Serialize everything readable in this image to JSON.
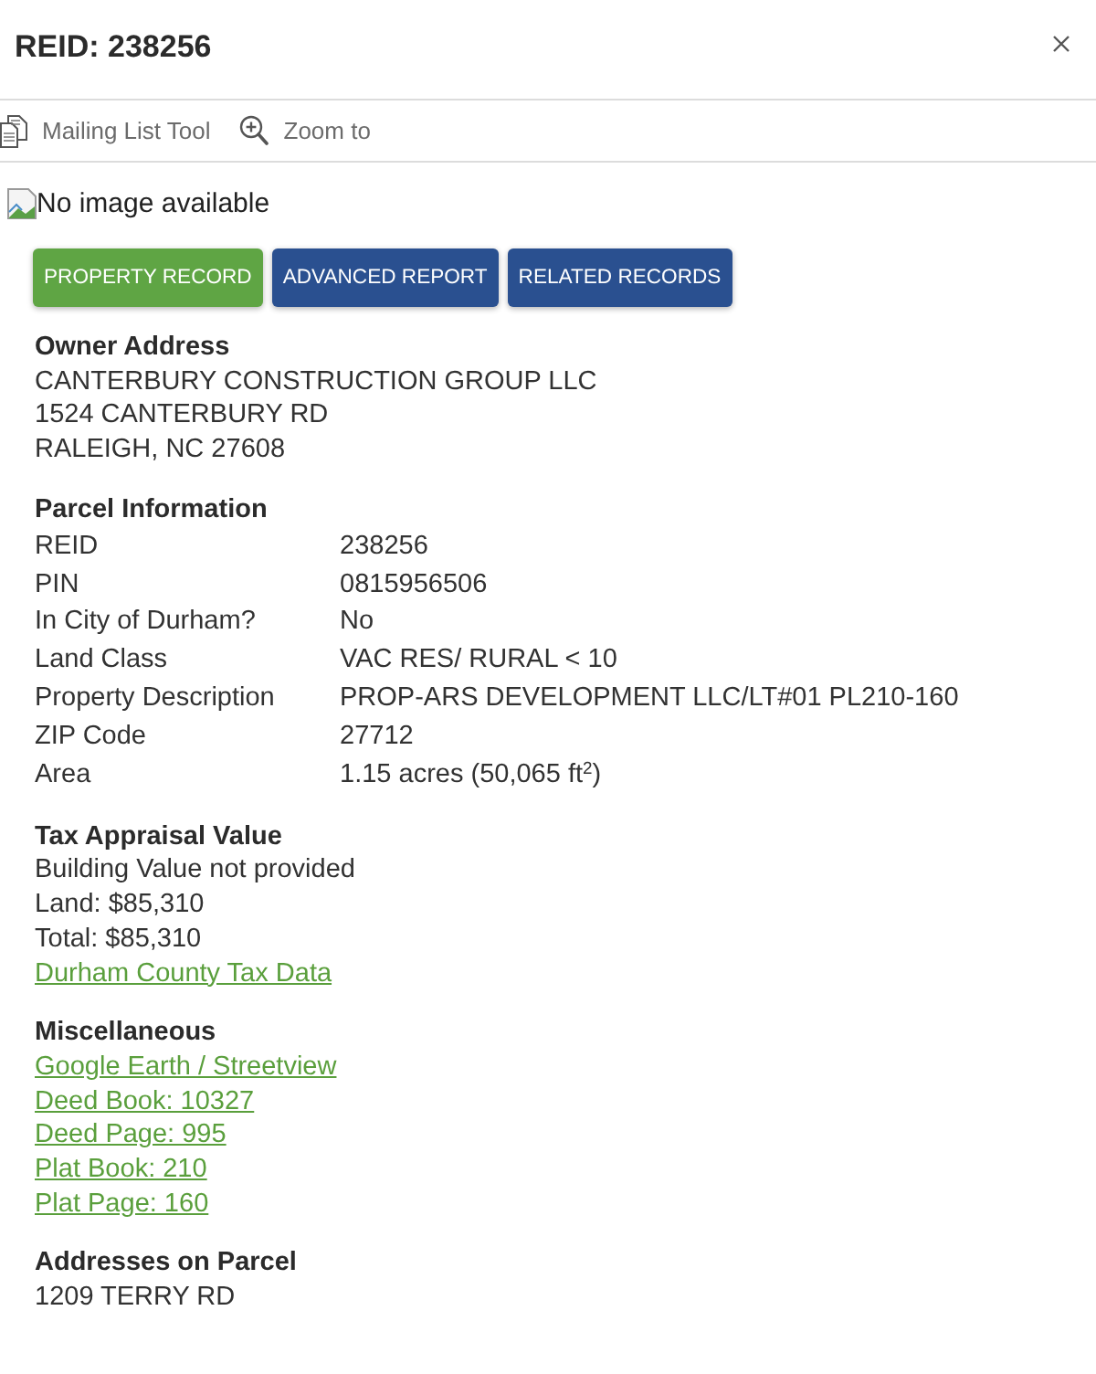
{
  "header": {
    "title": "REID: 238256"
  },
  "toolbar": [
    {
      "kind": "mailing",
      "label": "Mailing List Tool"
    },
    {
      "kind": "zoom",
      "label": "Zoom to"
    }
  ],
  "image": {
    "alt": "No image available"
  },
  "buttons": [
    {
      "label": "PROPERTY RECORD",
      "color": "#5fa544"
    },
    {
      "label": "ADVANCED REPORT",
      "color": "#2a5090"
    },
    {
      "label": "RELATED RECORDS",
      "color": "#2a5090"
    }
  ],
  "sections": [
    {
      "kind": "list",
      "heading": "Owner Address",
      "items": [
        {
          "kind": "text",
          "text": "CANTERBURY CONSTRUCTION GROUP LLC"
        },
        {
          "kind": "text",
          "text": "1524 CANTERBURY RD"
        },
        {
          "kind": "text",
          "text": "RALEIGH, NC 27608"
        }
      ]
    },
    {
      "kind": "table",
      "heading": "Parcel Information",
      "rows": [
        {
          "label": "REID",
          "value": "238256"
        },
        {
          "label": "PIN",
          "value": "0815956506"
        },
        {
          "label": "In City of Durham?",
          "value": "No"
        },
        {
          "label": "Land Class",
          "value": "VAC RES/ RURAL < 10"
        },
        {
          "label": "Property Description",
          "value": "PROP-ARS DEVELOPMENT LLC/LT#01 PL210-160"
        },
        {
          "label": "ZIP Code",
          "value": "27712"
        },
        {
          "label": "Area",
          "value": "1.15 acres (50,065 ft$^{2}$)"
        }
      ]
    },
    {
      "kind": "list",
      "heading": "Tax Appraisal Value",
      "items": [
        {
          "kind": "text",
          "text": "Building Value not provided"
        },
        {
          "kind": "text",
          "text": "Land: $85,310"
        },
        {
          "kind": "text",
          "text": "Total: $85,310"
        },
        {
          "kind": "link",
          "text": "Durham County Tax Data"
        }
      ]
    },
    {
      "kind": "list",
      "heading": "Miscellaneous",
      "items": [
        {
          "kind": "link",
          "text": "Google Earth / Streetview"
        },
        {
          "kind": "link",
          "text": "Deed Book: 10327"
        },
        {
          "kind": "link",
          "text": "Deed Page: 995"
        },
        {
          "kind": "link",
          "text": "Plat Book: 210"
        },
        {
          "kind": "link",
          "text": "Plat Page: 160"
        }
      ]
    },
    {
      "kind": "list",
      "heading": "Addresses on Parcel",
      "items": [
        {
          "kind": "text",
          "text": "1209 TERRY RD"
        }
      ]
    }
  ]
}
